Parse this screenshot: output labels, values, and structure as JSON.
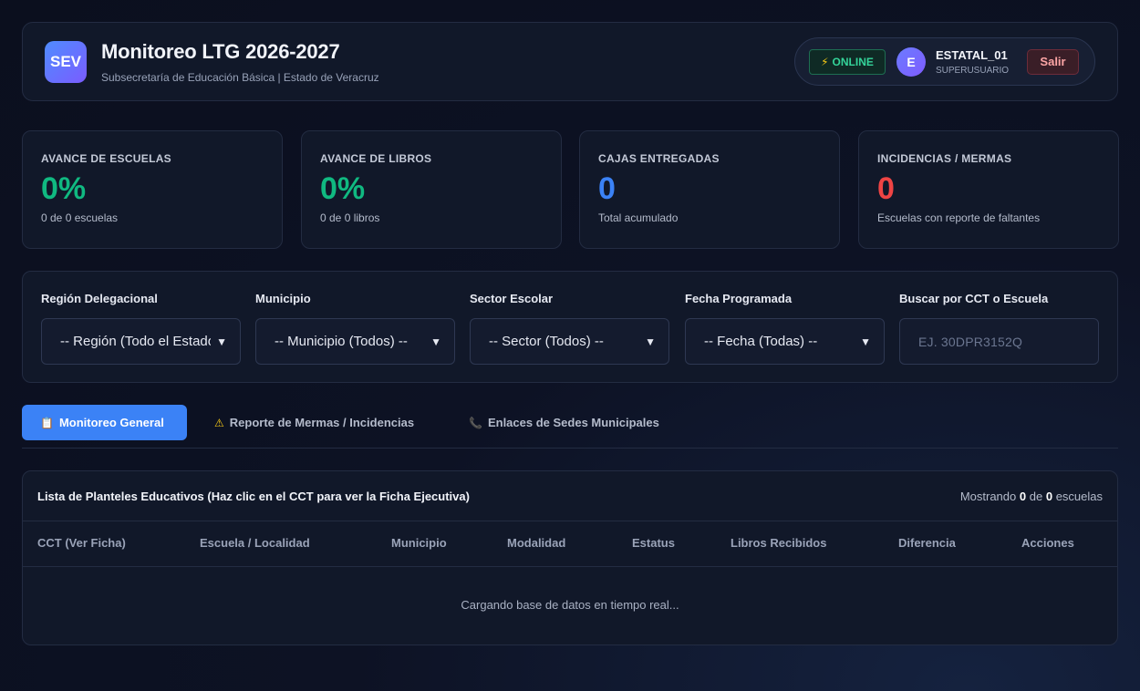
{
  "header": {
    "logo_text": "SEV",
    "title": "Monitoreo LTG 2026-2027",
    "subtitle": "Subsecretaría de Educación Básica | Estado de Veracruz",
    "status": {
      "icon": "lightning-icon",
      "label": "ONLINE",
      "color": "#34d399"
    },
    "user": {
      "avatar_letter": "E",
      "name": "ESTATAL_01",
      "role": "SUPERUSUARIO"
    },
    "logout_label": "Salir"
  },
  "stats": [
    {
      "label": "AVANCE DE ESCUELAS",
      "value": "0%",
      "sub": "0 de 0 escuelas",
      "color": "#10b981"
    },
    {
      "label": "AVANCE DE LIBROS",
      "value": "0%",
      "sub": "0 de 0 libros",
      "color": "#10b981"
    },
    {
      "label": "CAJAS ENTREGADAS",
      "value": "0",
      "sub": "Total acumulado",
      "color": "#3b82f6"
    },
    {
      "label": "INCIDENCIAS / MERMAS",
      "value": "0",
      "sub": "Escuelas con reporte de faltantes",
      "color": "#ef4444"
    }
  ],
  "filters": {
    "region": {
      "label": "Región Delegacional",
      "value": "-- Región (Todo el Estado) --"
    },
    "municipio": {
      "label": "Municipio",
      "value": "-- Municipio (Todos) --"
    },
    "sector": {
      "label": "Sector Escolar",
      "value": "-- Sector (Todos) --"
    },
    "fecha": {
      "label": "Fecha Programada",
      "value": "-- Fecha (Todas) --"
    },
    "buscar": {
      "label": "Buscar por CCT o Escuela",
      "placeholder": "Ej. 30DPR3152Q"
    }
  },
  "tabs": [
    {
      "icon": "clipboard-icon",
      "label": "Monitoreo General",
      "active": true
    },
    {
      "icon": "warning-icon",
      "label": "Reporte de Mermas / Incidencias",
      "active": false
    },
    {
      "icon": "phone-icon",
      "label": "Enlaces de Sedes Municipales",
      "active": false
    }
  ],
  "table": {
    "title": "Lista de Planteles Educativos (Haz clic en el CCT para ver la Ficha Ejecutiva)",
    "count_prefix": "Mostrando",
    "count_shown": "0",
    "count_mid": "de",
    "count_total": "0",
    "count_suffix": "escuelas",
    "columns": [
      "CCT (Ver Ficha)",
      "Escuela / Localidad",
      "Municipio",
      "Modalidad",
      "Estatus",
      "Libros Recibidos",
      "Diferencia",
      "Acciones"
    ],
    "loading_text": "Cargando base de datos en tiempo real..."
  },
  "colors": {
    "accent": "#3b82f6",
    "success": "#10b981",
    "danger": "#ef4444"
  }
}
